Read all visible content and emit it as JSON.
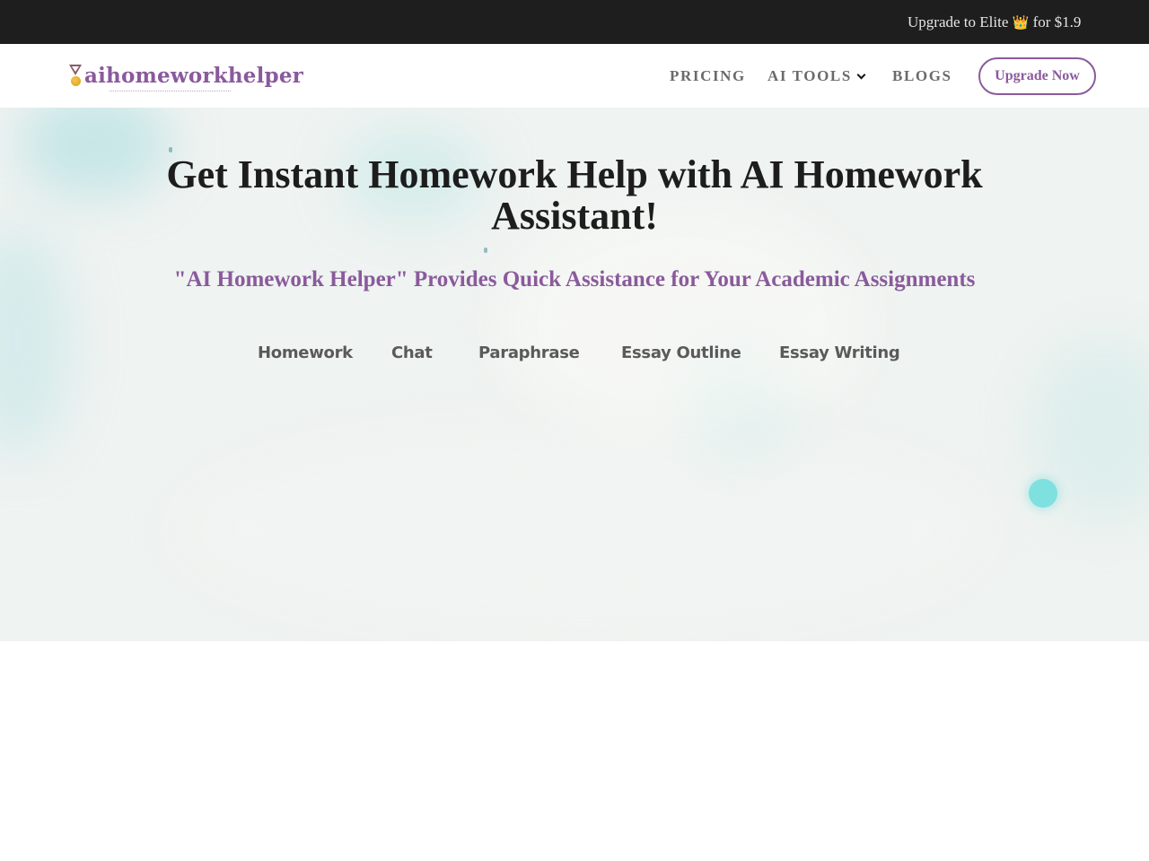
{
  "promo_bar": {
    "text_prefix": "Upgrade to ",
    "plan": "Elite",
    "crown_icon": "👑",
    "text_suffix": "for $1.9"
  },
  "header": {
    "logo_text": "aihomeworkhelper",
    "nav": {
      "pricing": "PRICING",
      "ai_tools": "AI TOOLS",
      "blogs": "BLOGS"
    },
    "upgrade_button": "Upgrade Now"
  },
  "hero": {
    "title_line1": "Get Instant Homework Help with AI Homework",
    "title_line2": "Assistant!",
    "subtitle": "\"AI Homework Helper\" Provides Quick Assistance for Your Academic Assignments",
    "tabs": [
      "Homework",
      "Chat",
      "Paraphrase",
      "Essay Outline",
      "Essay Writing"
    ]
  },
  "colors": {
    "brand_purple": "#8a5a9c",
    "promo_bg": "#1e1e1e",
    "title_text": "#1d1d1d",
    "tab_text": "#5a5a5a",
    "accent_teal": "#7fe0e0"
  }
}
